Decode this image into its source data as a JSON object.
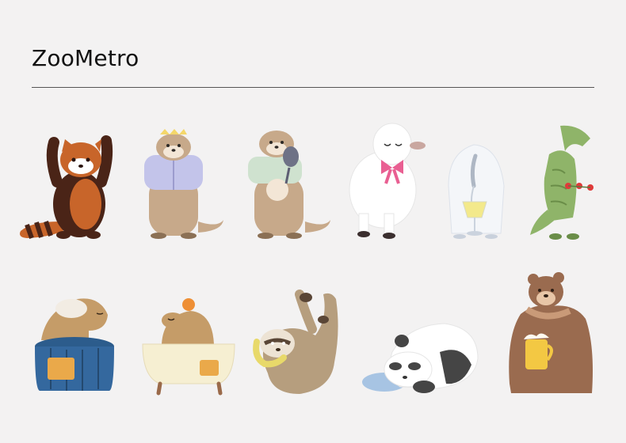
{
  "brand": {
    "name": "ZooMetro"
  },
  "animals": [
    {
      "icon": "red-panda-cheering-icon",
      "colors": {
        "fur": "#c8652a",
        "dark": "#4a2417"
      }
    },
    {
      "icon": "otter-in-lavender-cardigan-icon",
      "colors": {
        "fur": "#c7a98a",
        "top": "#c3c4ea"
      }
    },
    {
      "icon": "otter-with-hand-mirror-icon",
      "colors": {
        "fur": "#c7a98a",
        "top": "#cfe2cf"
      }
    },
    {
      "icon": "sheep-with-pink-bow-icon",
      "colors": {
        "wool": "#ffffff",
        "bow": "#e95f92"
      }
    },
    {
      "icon": "polar-bear-with-drink-icon",
      "colors": {
        "fur": "#f4f6f9",
        "drink": "#f3e98b"
      }
    },
    {
      "icon": "crocodile-holding-flower-icon",
      "colors": {
        "skin": "#8fb469",
        "flower": "#e03a3a"
      }
    },
    {
      "icon": "capybara-in-blue-tub-icon",
      "colors": {
        "fur": "#c59c68",
        "tub": "#34689e"
      }
    },
    {
      "icon": "capybara-in-bathtub-icon",
      "colors": {
        "fur": "#c59c68",
        "tub": "#f6efd2"
      }
    },
    {
      "icon": "sloth-with-banana-icon",
      "colors": {
        "fur": "#b69e7e",
        "banana": "#e8d96a"
      }
    },
    {
      "icon": "panda-sleeping-on-pillow-icon",
      "colors": {
        "fur": "#ffffff",
        "pillow": "#a7c4e3"
      }
    },
    {
      "icon": "brown-bear-with-beer-icon",
      "colors": {
        "fur": "#9a6b4f",
        "beer": "#f3c843"
      }
    }
  ]
}
